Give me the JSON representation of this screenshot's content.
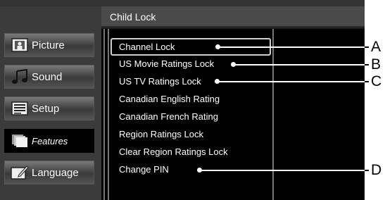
{
  "header": {
    "title": "Child Lock"
  },
  "sidebar": {
    "tabs": [
      {
        "label": "Picture",
        "icon": "picture-icon",
        "selected": false
      },
      {
        "label": "Sound",
        "icon": "music-note-icon",
        "selected": false
      },
      {
        "label": "Setup",
        "icon": "setup-list-icon",
        "selected": false
      },
      {
        "label": "Features",
        "icon": "features-icon",
        "selected": true
      },
      {
        "label": "Language",
        "icon": "language-icon",
        "selected": false
      }
    ]
  },
  "menu": {
    "items": [
      {
        "label": "Channel Lock",
        "focused": true
      },
      {
        "label": "US Movie Ratings Lock"
      },
      {
        "label": "US TV Ratings Lock"
      },
      {
        "label": "Canadian English Rating"
      },
      {
        "label": "Canadian French Rating"
      },
      {
        "label": "Region Ratings Lock"
      },
      {
        "label": "Clear Region Ratings Lock"
      },
      {
        "label": "Change PIN"
      }
    ]
  },
  "callouts": [
    {
      "letter": "A",
      "target": "Channel Lock"
    },
    {
      "letter": "B",
      "target": "US Movie Ratings Lock"
    },
    {
      "letter": "C",
      "target": "US TV Ratings Lock"
    },
    {
      "letter": "D",
      "target": "Change PIN"
    }
  ]
}
